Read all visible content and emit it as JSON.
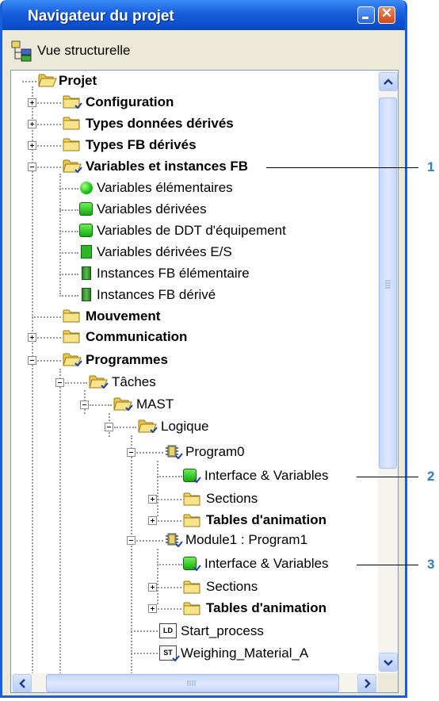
{
  "window": {
    "title": "Navigateur du projet"
  },
  "toolbar": {
    "view_label": "Vue structurelle",
    "view_icon": "structure-view-icon"
  },
  "tree": {
    "projet": "Projet",
    "configuration": "Configuration",
    "types_ddt": "Types données dérivés",
    "types_fb": "Types FB dérivés",
    "variables_fb": "Variables et instances FB",
    "var_elem": "Variables élémentaires",
    "var_derivees": "Variables dérivées",
    "var_ddt_equip": "Variables de DDT d'équipement",
    "var_derivees_es": "Variables dérivées E/S",
    "inst_fb_elem": "Instances FB élémentaire",
    "inst_fb_derive": "Instances FB dérivé",
    "mouvement": "Mouvement",
    "communication": "Communication",
    "programmes": "Programmes",
    "taches": "Tâches",
    "mast": "MAST",
    "logique": "Logique",
    "program0": "Program0",
    "interface_vars_1": "Interface & Variables",
    "sections_1": "Sections",
    "tables_1": "Tables d'animation",
    "module1": "Module1 : Program1",
    "interface_vars_2": "Interface & Variables",
    "sections_2": "Sections",
    "tables_2": "Tables d'animation",
    "start_process": "Start_process",
    "start_process_lang": "LD",
    "weighing": "Weighing_Material_A",
    "weighing_lang": "ST"
  },
  "callouts": [
    "1",
    "2",
    "3"
  ],
  "colors": {
    "title_bar": "#1a61e0",
    "callout": "#2a7fc6",
    "green_icon": "#18a810",
    "folder": "#f2d35a"
  }
}
